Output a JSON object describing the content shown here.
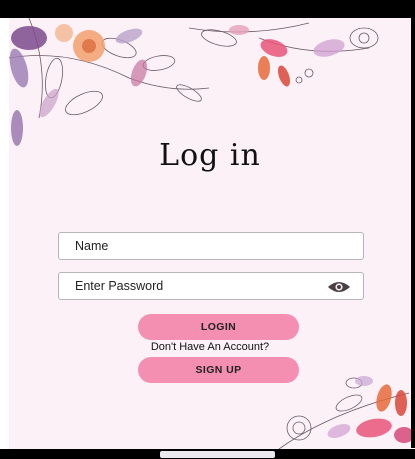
{
  "title": "Log in",
  "name_field": {
    "placeholder": "Name"
  },
  "password_field": {
    "placeholder": "Enter Password"
  },
  "login_button": {
    "label": "LOGIN"
  },
  "account_prompt": "Don't Have An Account?",
  "signup_button": {
    "label": "SIGN UP"
  },
  "icons": {
    "password_toggle": "eye-icon"
  },
  "colors": {
    "background": "#fdf1f8",
    "button": "#f48fb1",
    "field_border": "#b8b3b8",
    "eye_icon": "#4a3f44"
  }
}
